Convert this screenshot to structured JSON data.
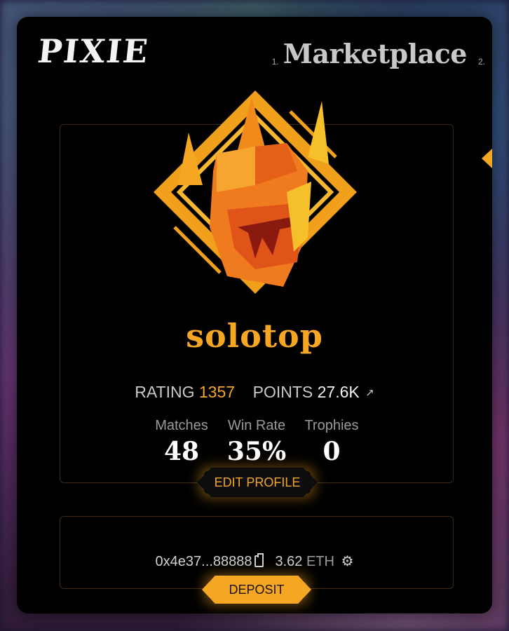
{
  "brand": {
    "logo_text": "PIXIE"
  },
  "nav": {
    "items": [
      {
        "num": "1.",
        "label": "Marketplace"
      },
      {
        "num": "2.",
        "label": ""
      }
    ]
  },
  "profile": {
    "username": "solotop",
    "rating_label": "RATING",
    "rating_value": "1357",
    "points_label": "POINTS",
    "points_value": "27.6K",
    "metrics": [
      {
        "label": "Matches",
        "value": "48"
      },
      {
        "label": "Win Rate",
        "value": "35%"
      },
      {
        "label": "Trophies",
        "value": "0"
      }
    ],
    "edit_button": "EDIT PROFILE",
    "emblem_icon": "crown-helmet-emblem-icon"
  },
  "wallet": {
    "address": "0x4e37...88888",
    "balance": "3.62",
    "currency": "ETH",
    "deposit_button": "DEPOSIT"
  },
  "colors": {
    "accent": "#f5a623",
    "panel_bg": "#000000",
    "text_muted": "#9a9a9a"
  }
}
